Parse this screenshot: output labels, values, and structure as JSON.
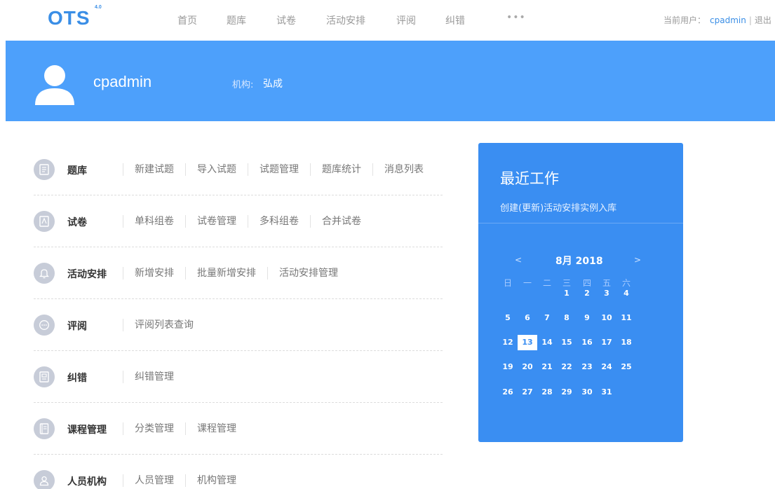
{
  "header": {
    "logo": "OTS",
    "logo_version": "4.0",
    "nav": [
      {
        "label": "首页"
      },
      {
        "label": "题库"
      },
      {
        "label": "试卷"
      },
      {
        "label": "活动安排"
      },
      {
        "label": "评阅"
      },
      {
        "label": "纠错"
      }
    ],
    "more": "•••",
    "current_user_label": "当前用户：",
    "current_user": "cpadmin",
    "separator": "|",
    "logout": "退出"
  },
  "banner": {
    "username": "cpadmin",
    "org_label": "机构:",
    "org_value": "弘成",
    "icon": "user-avatar-icon",
    "background": "#4da0fb"
  },
  "menu": [
    {
      "title": "题库",
      "icon": "document-icon",
      "links": [
        "新建试题",
        "导入试题",
        "试题管理",
        "题库统计",
        "消息列表"
      ]
    },
    {
      "title": "试卷",
      "icon": "paper-icon",
      "links": [
        "单科组卷",
        "试卷管理",
        "多科组卷",
        "合并试卷"
      ]
    },
    {
      "title": "活动安排",
      "icon": "bell-icon",
      "links": [
        "新增安排",
        "批量新增安排",
        "活动安排管理"
      ]
    },
    {
      "title": "评阅",
      "icon": "chat-icon",
      "links": [
        "评阅列表查询"
      ]
    },
    {
      "title": "纠错",
      "icon": "file-icon",
      "links": [
        "纠错管理"
      ]
    },
    {
      "title": "课程管理",
      "icon": "book-icon",
      "links": [
        "分类管理",
        "课程管理"
      ]
    },
    {
      "title": "人员机构",
      "icon": "person-icon",
      "links": [
        "人员管理",
        "机构管理"
      ]
    }
  ],
  "recent": {
    "title": "最近工作",
    "subtitle": "创建(更新)活动安排实例入库",
    "background": "#3a8ef2"
  },
  "calendar": {
    "prev": "<",
    "next": ">",
    "month": "8月 2018",
    "weekdays": [
      "日",
      "一",
      "二",
      "三",
      "四",
      "五",
      "六"
    ],
    "weeks": [
      [
        "",
        "",
        "",
        "1",
        "2",
        "3",
        "4"
      ],
      [
        "5",
        "6",
        "7",
        "8",
        "9",
        "10",
        "11"
      ],
      [
        "12",
        "13",
        "14",
        "15",
        "16",
        "17",
        "18"
      ],
      [
        "19",
        "20",
        "21",
        "22",
        "23",
        "24",
        "25"
      ],
      [
        "26",
        "27",
        "28",
        "29",
        "30",
        "31",
        ""
      ]
    ],
    "today": "13"
  }
}
